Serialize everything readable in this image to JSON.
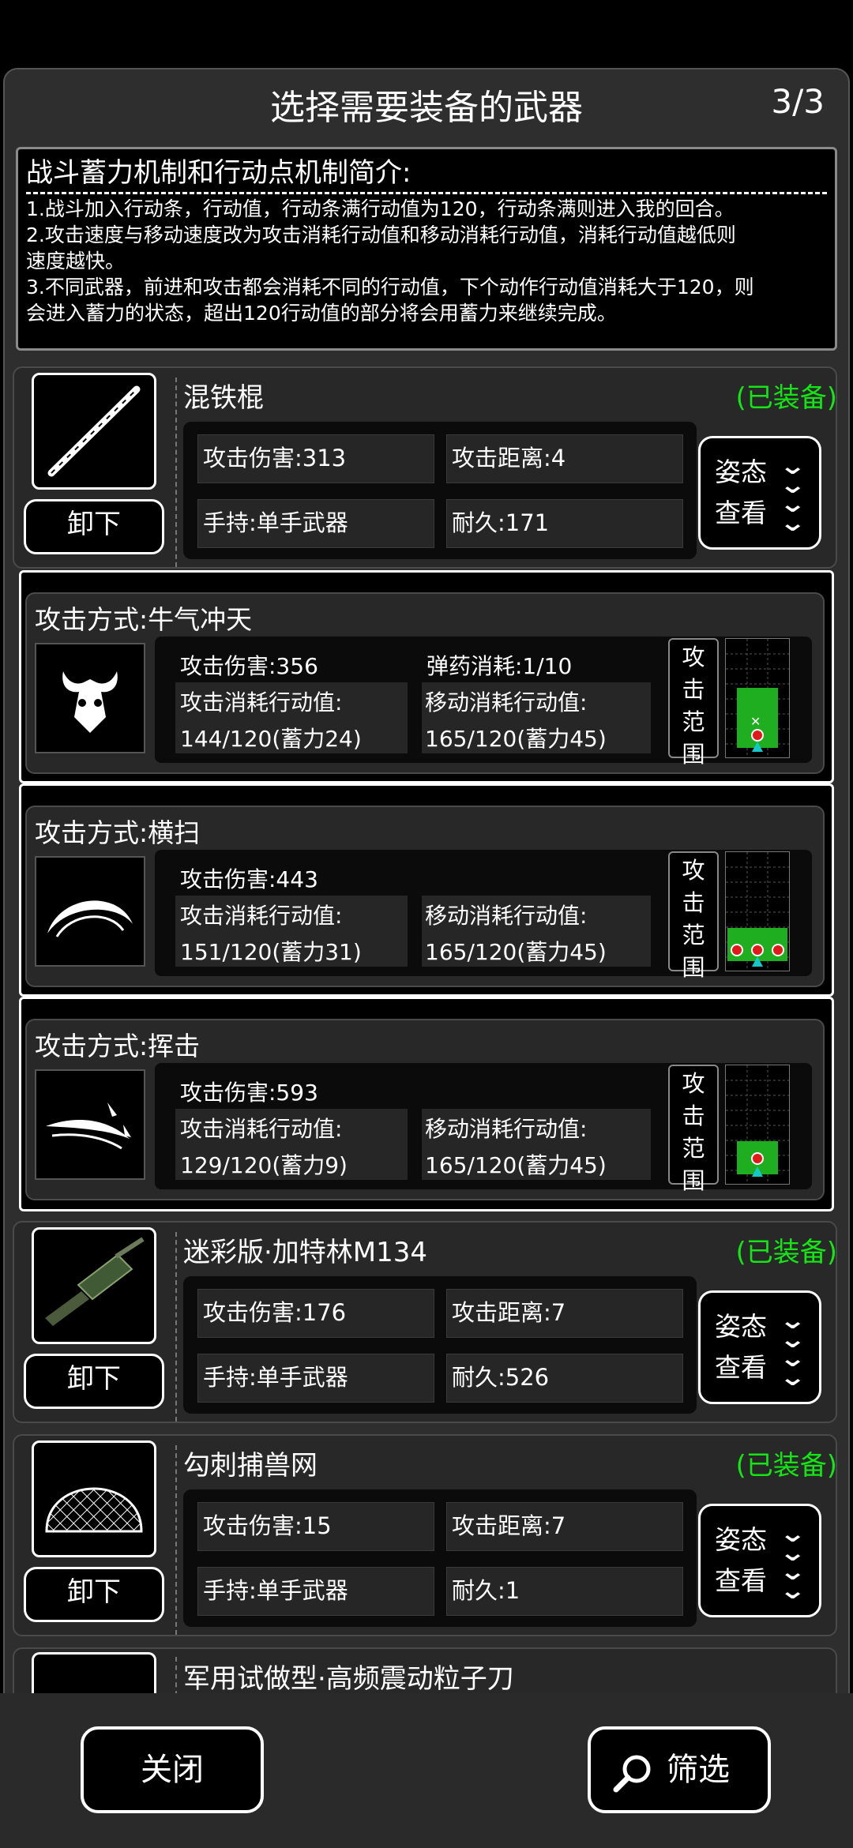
{
  "header": {
    "title": "选择需要装备的武器",
    "page_indicator": "3/3"
  },
  "intro": {
    "title": "战斗蓄力机制和行动点机制简介:",
    "lines": [
      "1.战斗加入行动条，行动值，行动条满行动值为120，行动条满则进入我的回合。",
      "2.攻击速度与移动速度改为攻击消耗行动值和移动消耗行动值，消耗行动值越低则",
      "速度越快。",
      "3.不同武器，前进和攻击都会消耗不同的行动值，下个动作行动值消耗大于120，则",
      "会进入蓄力的状态，超出120行动值的部分将会用蓄力来继续完成。"
    ]
  },
  "labels": {
    "unequip": "卸下",
    "stance": "姿态",
    "view": "查看",
    "range_chars": [
      "攻",
      "击",
      "范",
      "围"
    ]
  },
  "weapons": [
    {
      "name": "混铁棍",
      "status": "(已装备)",
      "damage": "攻击伤害:313",
      "distance": "攻击距离:4",
      "hold": "手持:单手武器",
      "durability": "耐久:171"
    },
    {
      "name": "迷彩版·加特林M134",
      "status": "(已装备)",
      "damage": "攻击伤害:176",
      "distance": "攻击距离:7",
      "hold": "手持:单手武器",
      "durability": "耐久:526"
    },
    {
      "name": "勾刺捕兽网",
      "status": "(已装备)",
      "damage": "攻击伤害:15",
      "distance": "攻击距离:7",
      "hold": "手持:单手武器",
      "durability": "耐久:1"
    },
    {
      "name": "军用试做型·高频震动粒子刀"
    }
  ],
  "attacks": [
    {
      "name": "攻击方式:牛气冲天",
      "damage": "攻击伤害:356",
      "ammo": "弹药消耗:1/10",
      "atk_label": "攻击消耗行动值:",
      "atk_value": "144/120(蓄力24)",
      "move_label": "移动消耗行动值:",
      "move_value": "165/120(蓄力45)"
    },
    {
      "name": "攻击方式:横扫",
      "damage": "攻击伤害:443",
      "ammo": "",
      "atk_label": "攻击消耗行动值:",
      "atk_value": "151/120(蓄力31)",
      "move_label": "移动消耗行动值:",
      "move_value": "165/120(蓄力45)"
    },
    {
      "name": "攻击方式:挥击",
      "damage": "攻击伤害:593",
      "ammo": "",
      "atk_label": "攻击消耗行动值:",
      "atk_value": "129/120(蓄力9)",
      "move_label": "移动消耗行动值:",
      "move_value": "165/120(蓄力45)"
    }
  ],
  "footer": {
    "close": "关闭",
    "filter": "筛选"
  },
  "colors": {
    "equipped": "#15e515",
    "range_fill": "#1fae1f",
    "marker": "#e01a1a",
    "player": "#16c7c7"
  }
}
